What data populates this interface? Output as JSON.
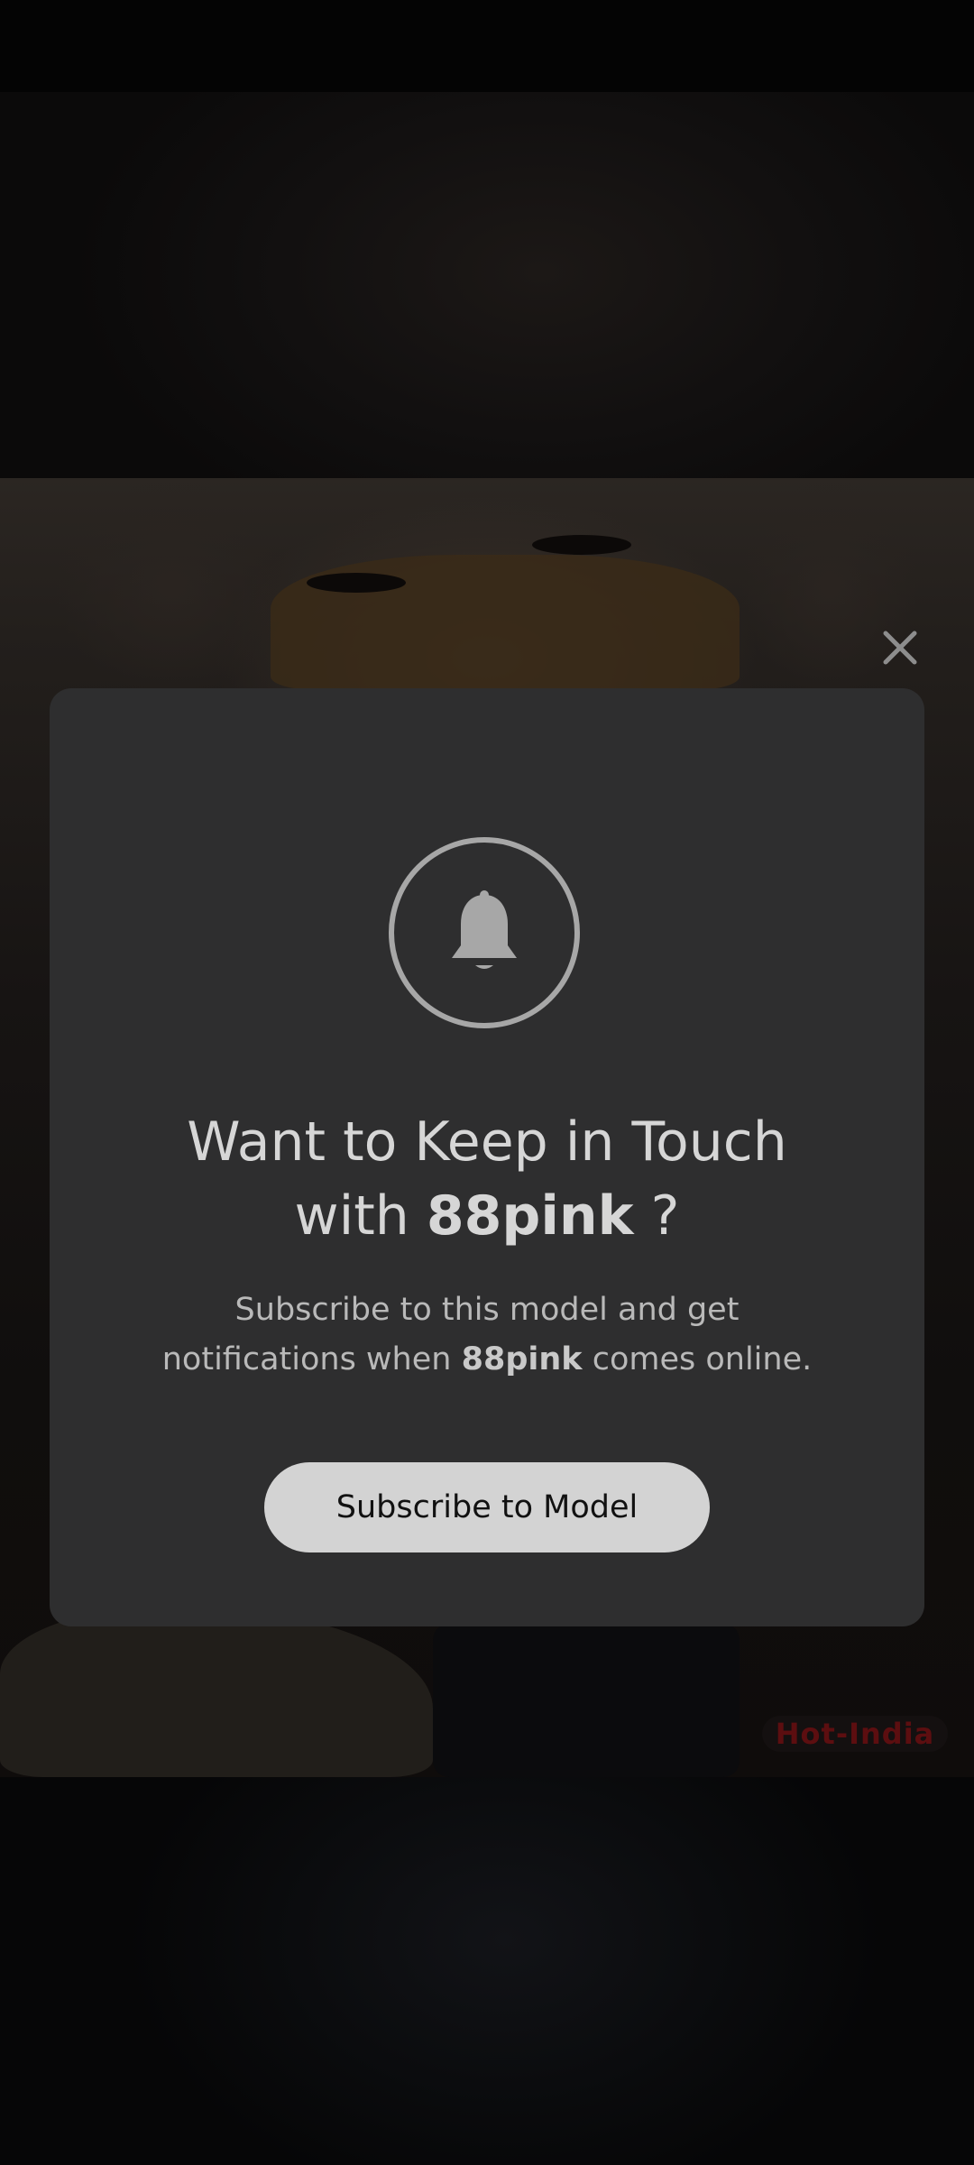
{
  "modal": {
    "title_prefix": "Want to Keep in Touch",
    "title_with": "with",
    "model_name": "88pink",
    "title_suffix": "?",
    "subtitle_line1": "Subscribe to this model and get",
    "subtitle_prefix": "notifications when",
    "subtitle_suffix": "comes online.",
    "subscribe_label": "Subscribe to Model",
    "icon": "bell-icon"
  },
  "overlay": {
    "close_icon": "close-icon"
  },
  "stream": {
    "watermark": "Hot-India"
  },
  "colors": {
    "modal_bg": "#2e2e2f",
    "button_bg": "#d3d3d3",
    "icon_gray": "#a7a7a7",
    "watermark": "#5c0e10"
  }
}
